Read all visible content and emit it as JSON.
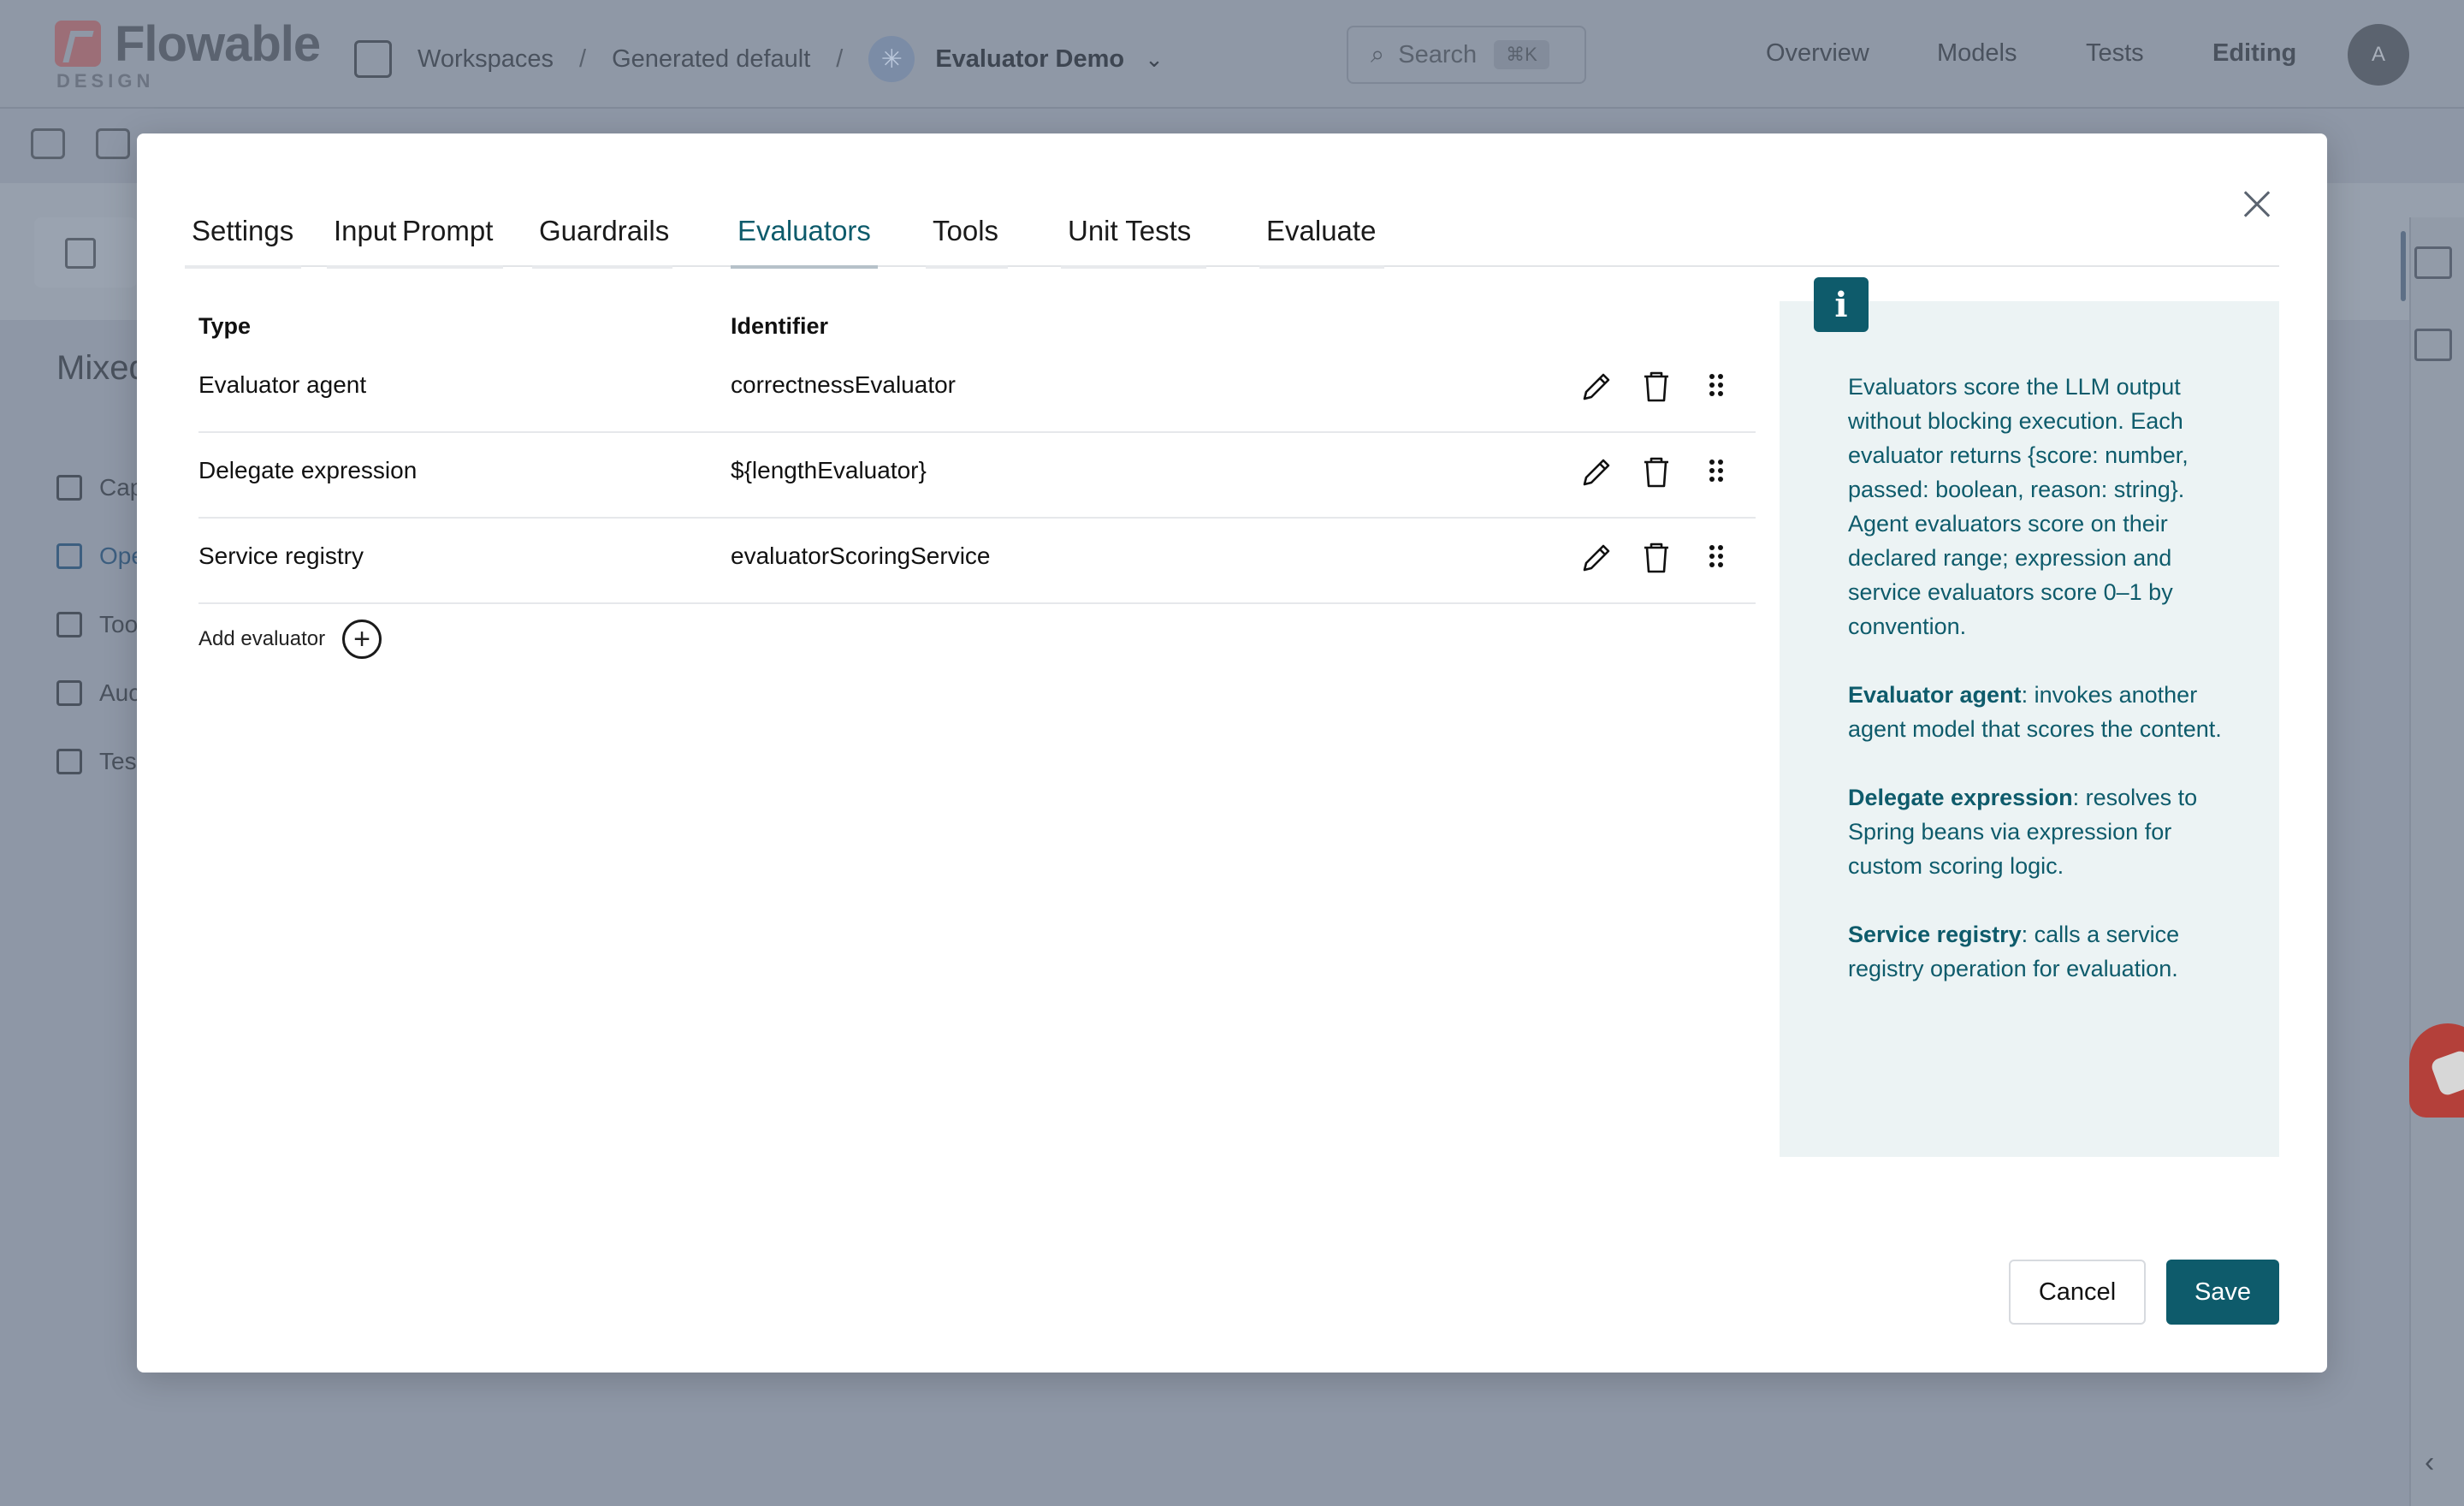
{
  "app": {
    "brand": "Flowable",
    "brand_sub": "DESIGN",
    "breadcrumbs": [
      "Workspaces",
      "Generated default",
      "Evaluator Demo"
    ],
    "search_placeholder": "Search",
    "search_shortcut": "⌘K",
    "nav": [
      "Overview",
      "Models",
      "Tests",
      "Editing"
    ],
    "avatar_initial": "A"
  },
  "sidebar_bg": {
    "title": "Mixed",
    "items": [
      "Cap",
      "Ope",
      "Too",
      "Auc",
      "Tes"
    ]
  },
  "modal": {
    "tabs": [
      "Settings",
      "Input",
      "Prompt",
      "Guardrails",
      "Evaluators",
      "Tools",
      "Unit Tests",
      "Evaluate"
    ],
    "active_tab": "Evaluators",
    "columns": {
      "type": "Type",
      "identifier": "Identifier"
    },
    "rows": [
      {
        "type": "Evaluator agent",
        "identifier": "correctnessEvaluator"
      },
      {
        "type": "Delegate expression",
        "identifier": "${lengthEvaluator}"
      },
      {
        "type": "Service registry",
        "identifier": "evaluatorScoringService"
      }
    ],
    "add_label": "Add evaluator",
    "info": {
      "intro": "Evaluators score the LLM output without blocking execution. Each evaluator returns {score: number, passed: boolean, reason: string}. Agent evaluators score on their declared range; expression and service evaluators score 0–1 by convention.",
      "items": [
        {
          "term": "Evaluator agent",
          "desc": ": invokes another agent model that scores the content."
        },
        {
          "term": "Delegate expression",
          "desc": ": resolves to Spring beans via expression for custom scoring logic."
        },
        {
          "term": "Service registry",
          "desc": ": calls a service registry operation for evaluation."
        }
      ]
    },
    "cancel_label": "Cancel",
    "save_label": "Save"
  },
  "colors": {
    "accent": "#0e5b6b",
    "info_bg": "#ecf3f4",
    "overlay": "#8e97a6"
  }
}
